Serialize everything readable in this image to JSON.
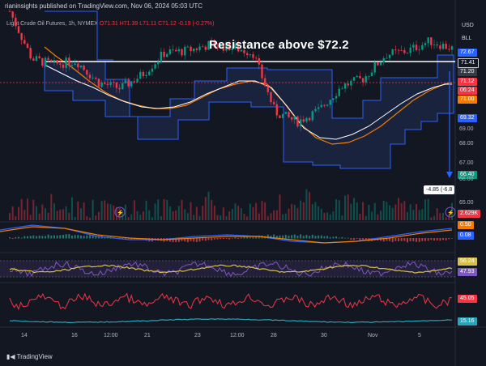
{
  "header": {
    "publisher_line": "rianinsights published on TradingView.com, Nov 06, 2024 05:03 UTC",
    "symbol": "Light Crude Oil Futures, 1h, NYMEX",
    "open_label": "O71.31",
    "high_label": "H71.39",
    "low_label": "L71.11",
    "close_label": "C71.12",
    "change_label": "-0.19 (-0.27%)"
  },
  "annotation": {
    "title": "Resistance above $72.2",
    "callout": "-4.85 (-6.8"
  },
  "axis": {
    "currency": "USD",
    "unit": "BLL",
    "ticks": [
      "69.00",
      "68.00",
      "67.00",
      "66.00",
      "65.00"
    ]
  },
  "badges": [
    {
      "label": "72.67",
      "color": "#2962ff"
    },
    {
      "label": "71.41",
      "color": "#131722"
    },
    {
      "label": "71.20",
      "color": "#363a45"
    },
    {
      "label": "71.12",
      "color": "#f23645"
    },
    {
      "label": "06:24",
      "color": "#f23645"
    },
    {
      "label": "71.00",
      "color": "#f57c00"
    },
    {
      "label": "69.32",
      "color": "#2962ff"
    },
    {
      "label": "66.40",
      "color": "#089981"
    },
    {
      "label": "2.629K",
      "color": "#f23645"
    },
    {
      "label": "0.50",
      "color": "#f57c00"
    },
    {
      "label": "0.08",
      "color": "#2962ff"
    },
    {
      "label": "56.24",
      "color": "#d8c04a"
    },
    {
      "label": "47.93",
      "color": "#7e57c2"
    },
    {
      "label": "45.05",
      "color": "#f23645"
    },
    {
      "label": "15.16",
      "color": "#26a6b8"
    }
  ],
  "x_axis": [
    "14",
    "16",
    "12:00",
    "21",
    "23",
    "12:00",
    "28",
    "30",
    "Nov",
    "5"
  ],
  "branding": "TradingView",
  "colors": {
    "up": "#089981",
    "down": "#f23645",
    "channel": "#2962ff",
    "ma_fast": "#f57c00",
    "ma_slow": "#ffffff",
    "resistance": "#ffffff"
  },
  "chart_data": {
    "type": "candlestick",
    "title": "Light Crude Oil Futures, 1h, NYMEX",
    "x_range": [
      "Oct 14",
      "Nov 6"
    ],
    "ylim": [
      64.8,
      73.0
    ],
    "resistance_level": 71.41,
    "price_path": [
      {
        "x": "Oct 14",
        "y": 73.0
      },
      {
        "x": "Oct 15",
        "y": 70.6
      },
      {
        "x": "Oct 16",
        "y": 70.3
      },
      {
        "x": "Oct 17",
        "y": 70.5
      },
      {
        "x": "Oct 18",
        "y": 69.4
      },
      {
        "x": "Oct 19",
        "y": 69.1
      },
      {
        "x": "Oct 21",
        "y": 69.8
      },
      {
        "x": "Oct 22",
        "y": 70.9
      },
      {
        "x": "Oct 23",
        "y": 71.0
      },
      {
        "x": "Oct 24",
        "y": 71.3
      },
      {
        "x": "Oct 25",
        "y": 71.2
      },
      {
        "x": "Oct 27",
        "y": 70.9
      },
      {
        "x": "Oct 28",
        "y": 67.9
      },
      {
        "x": "Oct 29",
        "y": 67.4
      },
      {
        "x": "Oct 30",
        "y": 68.0
      },
      {
        "x": "Oct 31",
        "y": 69.2
      },
      {
        "x": "Nov 1",
        "y": 69.6
      },
      {
        "x": "Nov 3",
        "y": 70.8
      },
      {
        "x": "Nov 4",
        "y": 71.0
      },
      {
        "x": "Nov 5",
        "y": 71.5
      },
      {
        "x": "Nov 6",
        "y": 71.12
      }
    ],
    "change_callout": -4.85
  }
}
